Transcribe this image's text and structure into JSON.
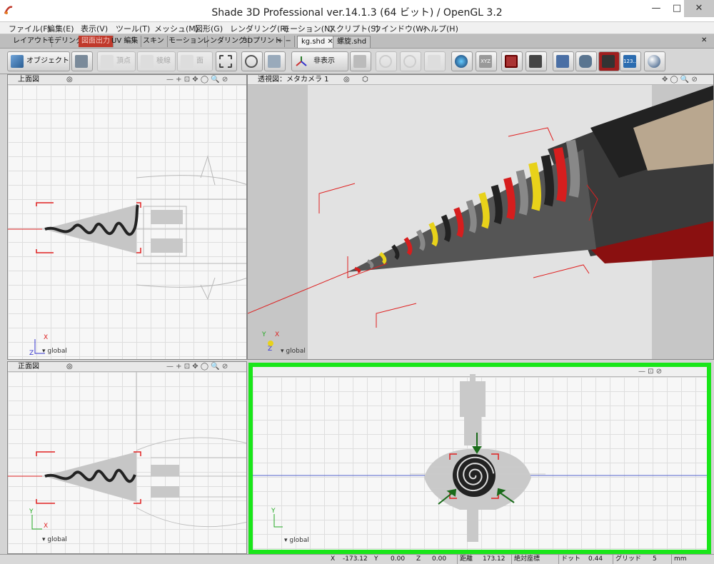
{
  "window": {
    "title": "Shade 3D Professional ver.14.1.3 (64 ビット) / OpenGL 3.2",
    "minimize": "—",
    "maximize": "□",
    "close": "✕"
  },
  "menu": [
    "ファイル(F)",
    "編集(E)",
    "表示(V)",
    "ツール(T)",
    "メッシュ(M)",
    "図形(G)",
    "レンダリング(R)",
    "モーション(N)",
    "スクリプト(S)",
    "ウインドウ(W)",
    "ヘルプ(H)"
  ],
  "workspace_tabs": [
    "レイアウト",
    "モデリング",
    "図面出力",
    "UV 編集",
    "スキン",
    "モーション",
    "レンダリング",
    "3Dプリント",
    "+ −"
  ],
  "doc_tabs": [
    {
      "label": "kg.shd",
      "close": "✕"
    },
    {
      "label": "螺旋.shd"
    }
  ],
  "toolbar": {
    "object_label": "オブジェクト",
    "vertex_label": "頂点",
    "edge_label": "稜線",
    "face_label": "面",
    "hide_label": "非表示",
    "num_label": "123..",
    "xyz_label": "XYZ"
  },
  "viewports": {
    "top": {
      "title": "上面図",
      "ctrl": "— + ⊡ ✥ ◯ 🔍 ⊘",
      "axis_x": "X",
      "axis_z": "Z",
      "global": "global"
    },
    "perspective": {
      "title": "透視図：メタカメラ 1",
      "ctrl": "✥ ◯ 🔍 ⊘",
      "axis_x": "X",
      "axis_y": "Y",
      "axis_z": "Z",
      "global": "global"
    },
    "front": {
      "title": "正面図",
      "ctrl": "— + ⊡ ✥ ◯ 🔍 ⊘",
      "axis_x": "X",
      "axis_y": "Y",
      "global": "global"
    },
    "side": {
      "ctrl": "— ⊡ ⊘",
      "axis_y": "Y",
      "global": "global"
    }
  },
  "status": {
    "x_label": "X",
    "x_value": "-173.12",
    "y_label": "Y",
    "y_value": "0.00",
    "z_label": "Z",
    "z_value": "0.00",
    "dist_label": "距離",
    "dist_value": "173.12",
    "coord_label": "絶対座標",
    "dot_label": "ドット",
    "dot_value": "0.44",
    "grid_label": "グリッド",
    "grid_value": "5",
    "unit": "mm"
  },
  "colors": {
    "highlight": "#19e619",
    "accent_red": "#c0392b",
    "stripe_yellow": "#e8d21a",
    "stripe_red": "#d61e1e"
  }
}
